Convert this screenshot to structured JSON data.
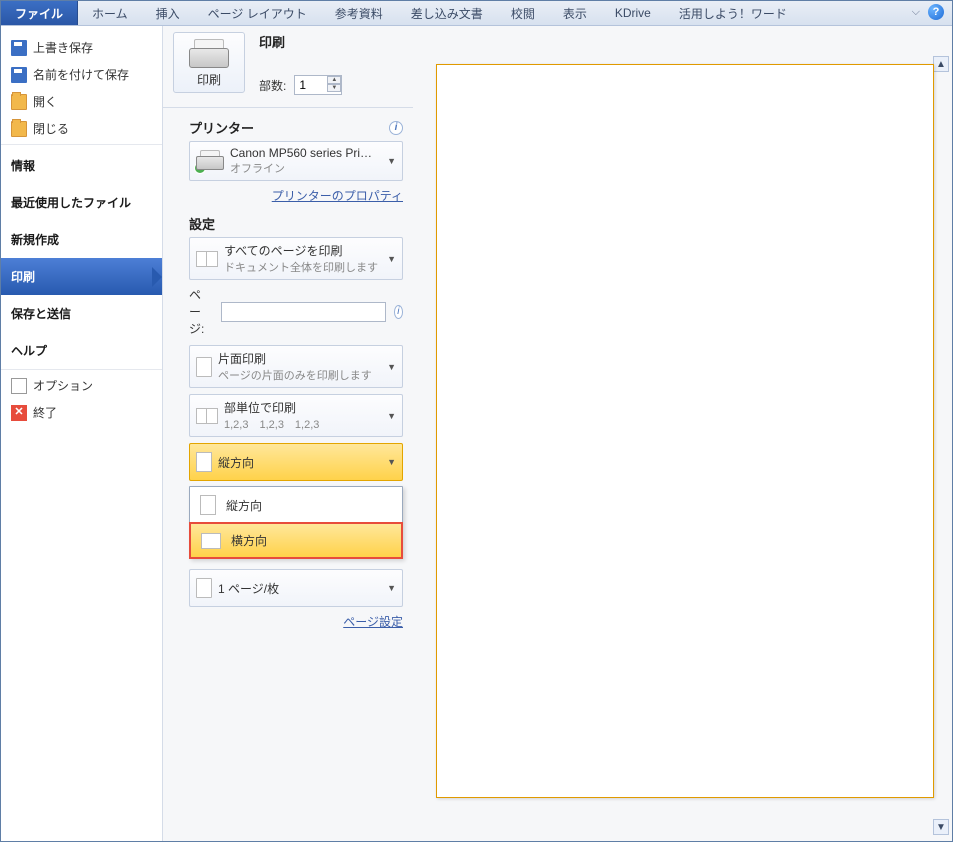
{
  "ribbon": {
    "file": "ファイル",
    "tabs": [
      "ホーム",
      "挿入",
      "ページ レイアウト",
      "参考資料",
      "差し込み文書",
      "校閲",
      "表示",
      "KDrive",
      "活用しよう！ワード"
    ]
  },
  "sidebar": {
    "save": "上書き保存",
    "saveas": "名前を付けて保存",
    "open": "開く",
    "close": "閉じる",
    "info": "情報",
    "recent": "最近使用したファイル",
    "new": "新規作成",
    "print": "印刷",
    "savesend": "保存と送信",
    "help": "ヘルプ",
    "options": "オプション",
    "exit": "終了"
  },
  "print": {
    "title": "印刷",
    "button_label": "印刷",
    "copies_label": "部数:",
    "copies_value": "1",
    "printer_section": "プリンター",
    "printer_name": "Canon MP560 series Pri…",
    "printer_status": "オフライン",
    "printer_props": "プリンターのプロパティ",
    "settings_section": "設定",
    "pages_label": "ページ:",
    "pages_value": "",
    "page_setup": "ページ設定",
    "opt_allpages_title": "すべてのページを印刷",
    "opt_allpages_sub": "ドキュメント全体を印刷します",
    "opt_oneside_title": "片面印刷",
    "opt_oneside_sub": "ページの片面のみを印刷します",
    "opt_collate_title": "部単位で印刷",
    "opt_collate_sub": "1,2,3　1,2,3　1,2,3",
    "opt_orient": "縦方向",
    "orient_options": {
      "portrait": "縦方向",
      "landscape": "横方向"
    },
    "opt_perpage": "1 ページ/枚"
  }
}
